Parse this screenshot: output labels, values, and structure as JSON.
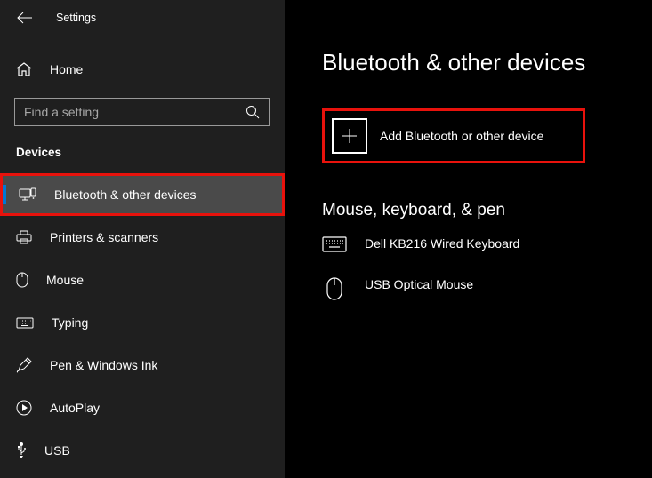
{
  "titlebar": {
    "title": "Settings"
  },
  "sidebar": {
    "home": "Home",
    "search_placeholder": "Find a setting",
    "section": "Devices",
    "items": [
      {
        "label": "Bluetooth & other devices"
      },
      {
        "label": "Printers & scanners"
      },
      {
        "label": "Mouse"
      },
      {
        "label": "Typing"
      },
      {
        "label": "Pen & Windows Ink"
      },
      {
        "label": "AutoPlay"
      },
      {
        "label": "USB"
      }
    ]
  },
  "main": {
    "title": "Bluetooth & other devices",
    "add_label": "Add Bluetooth or other device",
    "section1_title": "Mouse, keyboard, & pen",
    "devices": [
      {
        "label": "Dell KB216 Wired Keyboard"
      },
      {
        "label": "USB Optical Mouse"
      }
    ]
  }
}
